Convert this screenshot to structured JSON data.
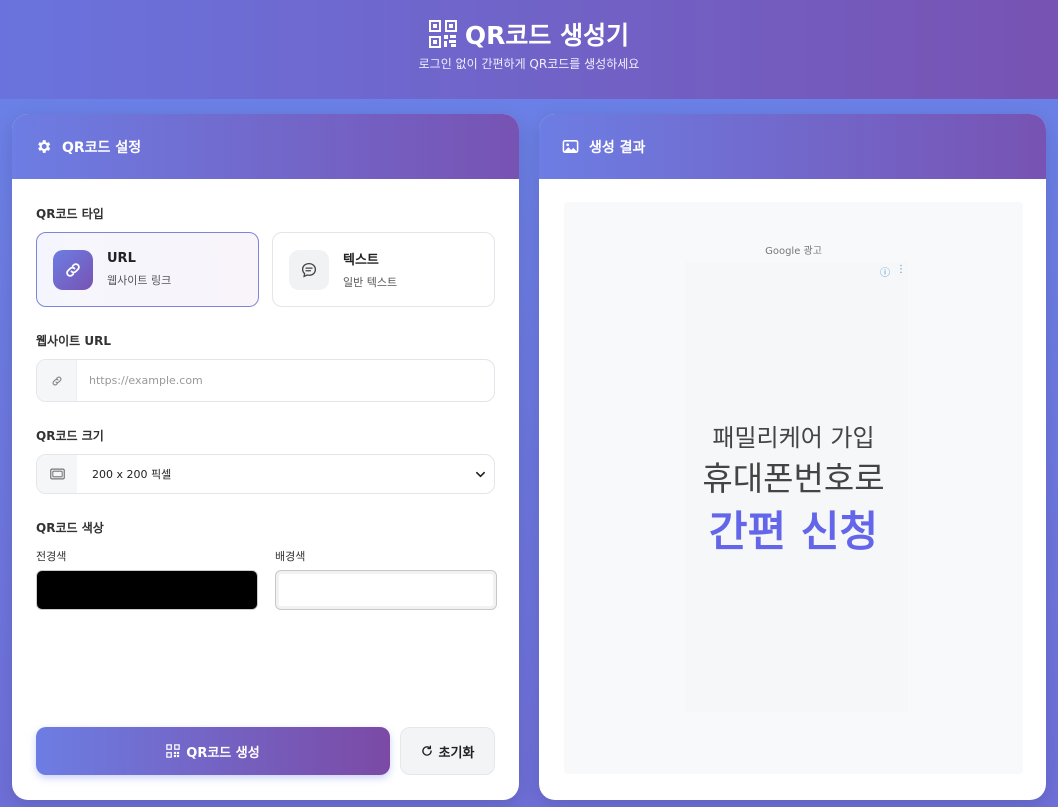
{
  "header": {
    "title": "QR코드 생성기",
    "subtitle": "로그인 없이 간편하게 QR코드를 생성하세요"
  },
  "settings": {
    "heading": "QR코드 설정",
    "type_label": "QR코드 타입",
    "types": [
      {
        "title": "URL",
        "desc": "웹사이트 링크",
        "icon": "link-icon",
        "active": true
      },
      {
        "title": "텍스트",
        "desc": "일반 텍스트",
        "icon": "chat-icon",
        "active": false
      }
    ],
    "url_label": "웹사이트 URL",
    "url_value": "",
    "url_placeholder": "https://example.com",
    "size_label": "QR코드 크기",
    "size_value": "200 x 200 픽셀",
    "color_label": "QR코드 색상",
    "fg_label": "전경색",
    "bg_label": "배경색",
    "fg_color": "#000000",
    "bg_color": "#ffffff",
    "generate_label": "QR코드 생성",
    "reset_label": "초기화"
  },
  "result": {
    "heading": "생성 결과",
    "ad_label": "Google 광고",
    "ad_line1": "패밀리케어 가입",
    "ad_line2": "휴대폰번호로",
    "ad_line3": "간편 신청"
  },
  "colors": {
    "accent_start": "#667eea",
    "accent_end": "#764ba2",
    "ad_accent": "#6366e9"
  }
}
